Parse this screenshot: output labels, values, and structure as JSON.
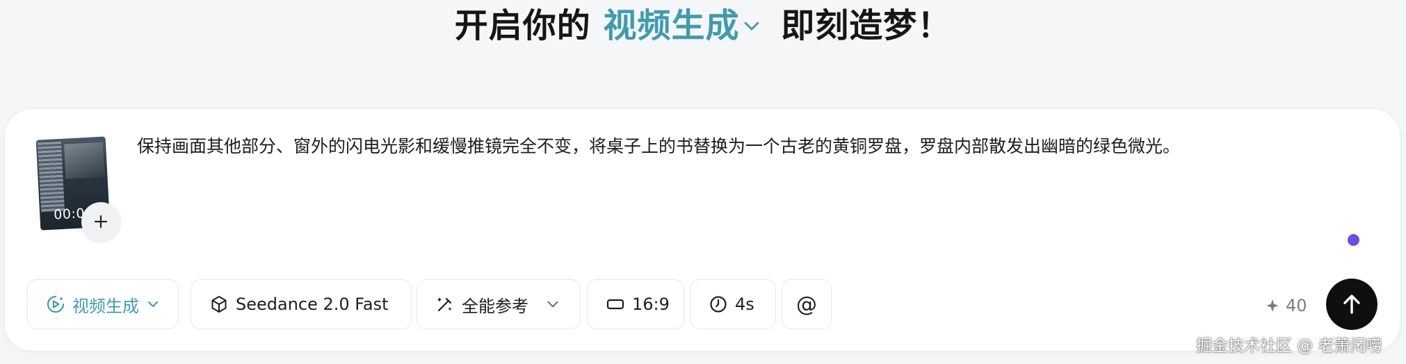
{
  "header": {
    "prefix": "开启你的",
    "mode_label": "视频生成",
    "suffix": "即刻造梦！"
  },
  "composer": {
    "thumbnail_timecode": "00:0",
    "add_icon": "plus-icon",
    "prompt_text": "保持画面其他部分、窗外的闪电光影和缓慢推镜完全不变，将桌子上的书替换为一个古老的黄铜罗盘，罗盘内部散发出幽暗的绿色微光。",
    "status_dot_color": "#6a4fe0"
  },
  "toolbar": {
    "mode": {
      "label": "视频生成",
      "icon": "video-generate-icon"
    },
    "model": {
      "label": "Seedance 2.0 Fast",
      "icon": "cube-icon"
    },
    "reference": {
      "label": "全能参考",
      "icon": "reference-wand-icon"
    },
    "ratio": {
      "label": "16:9",
      "icon": "aspect-ratio-icon"
    },
    "duration": {
      "label": "4s",
      "icon": "clock-icon"
    },
    "mention": {
      "label": "@"
    }
  },
  "credits": {
    "value": "40",
    "icon": "sparkle-icon"
  },
  "submit": {
    "icon": "arrow-up-icon"
  },
  "watermark": "掘金技术社区 @ 老萧闲唠",
  "colors": {
    "accent": "#3f9bb0",
    "submit_bg": "#0f0f0f",
    "background": "#f5f6f8"
  }
}
